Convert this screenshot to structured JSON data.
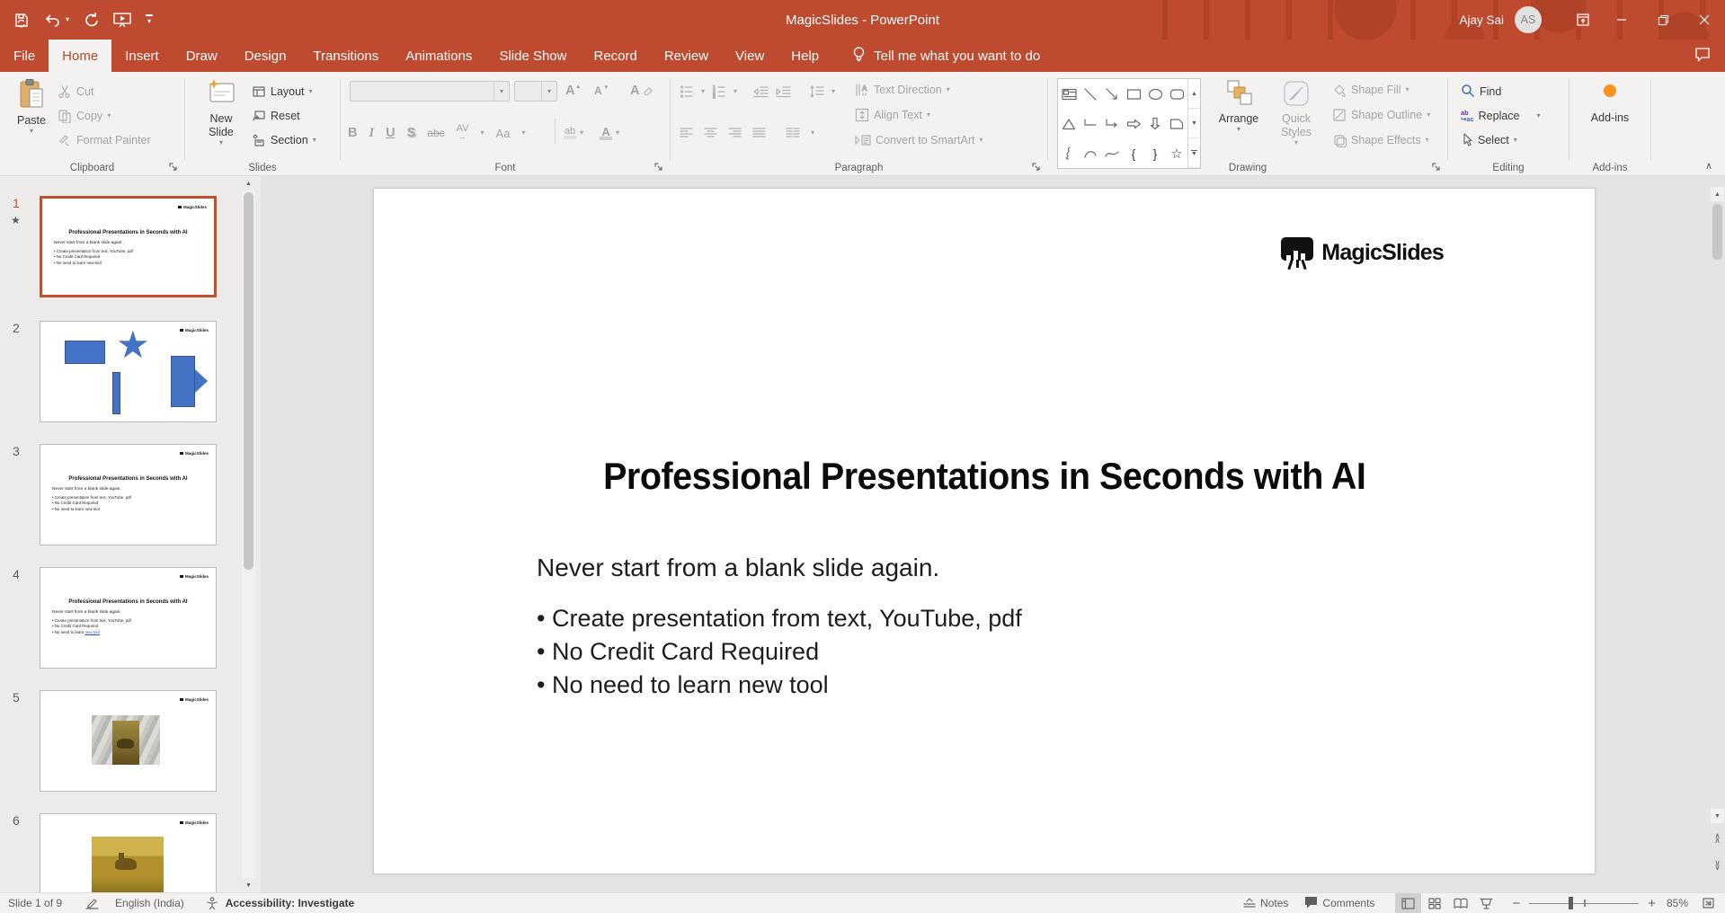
{
  "app": {
    "title": "MagicSlides  -  PowerPoint",
    "user": "Ajay Sai",
    "initials": "AS"
  },
  "tellme": {
    "label": "Tell me what you want to do"
  },
  "tabs": [
    {
      "label": "File"
    },
    {
      "label": "Home"
    },
    {
      "label": "Insert"
    },
    {
      "label": "Draw"
    },
    {
      "label": "Design"
    },
    {
      "label": "Transitions"
    },
    {
      "label": "Animations"
    },
    {
      "label": "Slide Show"
    },
    {
      "label": "Record"
    },
    {
      "label": "Review"
    },
    {
      "label": "View"
    },
    {
      "label": "Help"
    }
  ],
  "ribbon": {
    "clipboard": {
      "label": "Clipboard",
      "paste": "Paste",
      "cut": "Cut",
      "copy": "Copy",
      "format_painter": "Format Painter"
    },
    "slides": {
      "label": "Slides",
      "new_slide": "New Slide",
      "layout": "Layout",
      "reset": "Reset",
      "section": "Section"
    },
    "font": {
      "label": "Font",
      "bold": "B",
      "italic": "I",
      "underline": "U",
      "shadow": "S",
      "strike": "abc",
      "spacing": "AV",
      "case_btn": "Aa",
      "highlight": "ab",
      "color": "A"
    },
    "paragraph": {
      "label": "Paragraph",
      "text_direction": "Text Direction",
      "align_text": "Align Text",
      "smartart": "Convert to SmartArt"
    },
    "drawing": {
      "label": "Drawing",
      "arrange": "Arrange",
      "quick_styles": "Quick Styles",
      "shape_fill": "Shape Fill",
      "shape_outline": "Shape Outline",
      "shape_effects": "Shape Effects"
    },
    "editing": {
      "label": "Editing",
      "find": "Find",
      "replace": "Replace",
      "select_btn": "Select"
    },
    "addins": {
      "label": "Add-ins",
      "button": "Add-ins"
    }
  },
  "slide": {
    "logo": "MagicSlides",
    "title": "Professional Presentations in Seconds with AI",
    "subtitle": "Never start from a blank slide again.",
    "bullets": [
      "• Create presentation from text, YouTube, pdf",
      "• No Credit Card Required",
      "• No need to learn new tool"
    ]
  },
  "thumbnails": [
    {
      "n": "1"
    },
    {
      "n": "2"
    },
    {
      "n": "3"
    },
    {
      "n": "4"
    },
    {
      "n": "5"
    },
    {
      "n": "6"
    }
  ],
  "thumb_content": {
    "logo": "MagicSlides",
    "title": "Professional Presentations in Seconds with AI",
    "subtitle": "Never start from a blank slide again.",
    "b0": "• Create presentation from text, YouTube, pdf",
    "b1": "• No Credit Card Required",
    "b2": "• No need to learn new tool",
    "b2_prefix": "• No need to learn ",
    "link": "new tool"
  },
  "statusbar": {
    "slide_indicator": "Slide 1 of 9",
    "language": "English (India)",
    "accessibility": "Accessibility: Investigate",
    "notes": "Notes",
    "comments": "Comments",
    "zoom": "85%"
  },
  "colors": {
    "titlebar": "#BE4A2F",
    "tab_active_text": "#B7472A",
    "selection_border": "#C0502C",
    "shape_blue": "#4472C4",
    "addins_dot": "#F7941D"
  }
}
